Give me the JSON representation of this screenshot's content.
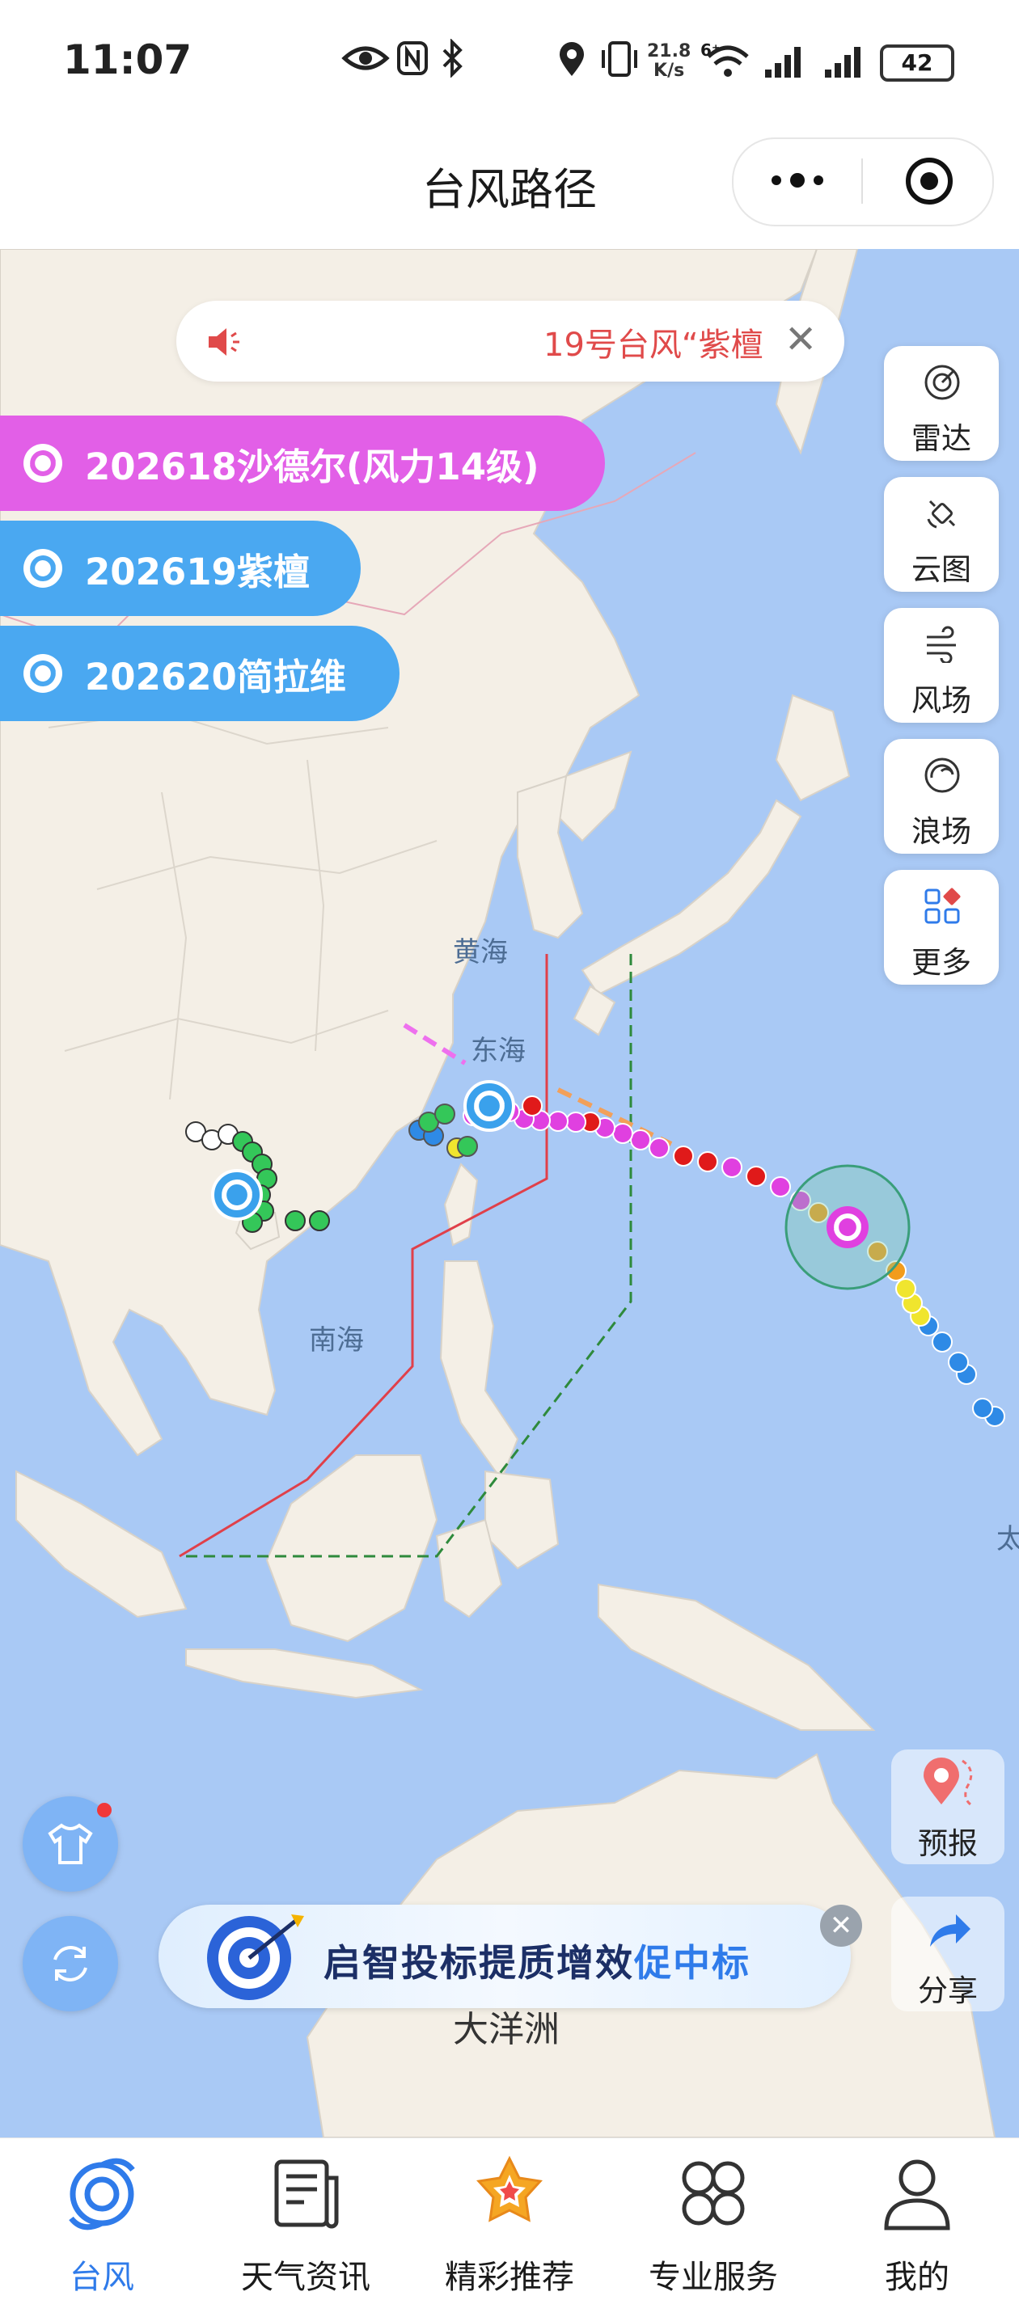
{
  "status_bar": {
    "time": "11:07",
    "net_speed_value": "21.8",
    "net_speed_unit": "K/s",
    "signal_tag": "6⁺",
    "battery": "42"
  },
  "header": {
    "title": "台风路径"
  },
  "notice": {
    "text": "19号台风“紫檀"
  },
  "typhoons": [
    {
      "label": "202618沙德尔(风力14级)",
      "color": "#e25fe7"
    },
    {
      "label": "202619紫檀",
      "color": "#4aa8f1"
    },
    {
      "label": "202620简拉维",
      "color": "#4aa8f1"
    }
  ],
  "map": {
    "labels": {
      "yellow_sea": "黄海",
      "east_sea": "东海",
      "south_sea": "南海",
      "pacific_cut": "太",
      "oceania": "大洋洲"
    },
    "track_colors": {
      "super_typhoon": "#e040e0",
      "typhoon": "#e01a1a",
      "strong_storm": "#f29c1c",
      "storm": "#f0e52e",
      "depression": "#2e8ae6",
      "tropical": "#34c759"
    }
  },
  "tools": [
    {
      "label": "雷达",
      "icon": "radar-icon"
    },
    {
      "label": "云图",
      "icon": "satellite-icon"
    },
    {
      "label": "风场",
      "icon": "wind-icon"
    },
    {
      "label": "浪场",
      "icon": "wave-icon"
    },
    {
      "label": "更多",
      "icon": "more-grid-icon"
    }
  ],
  "side_actions": {
    "forecast": "预报",
    "share": "分享"
  },
  "ad": {
    "text_main": "启智投标提质增效",
    "text_highlight": "促中标"
  },
  "nav": [
    {
      "label": "台风",
      "active": true
    },
    {
      "label": "天气资讯"
    },
    {
      "label": "精彩推荐"
    },
    {
      "label": "专业服务"
    },
    {
      "label": "我的"
    }
  ]
}
